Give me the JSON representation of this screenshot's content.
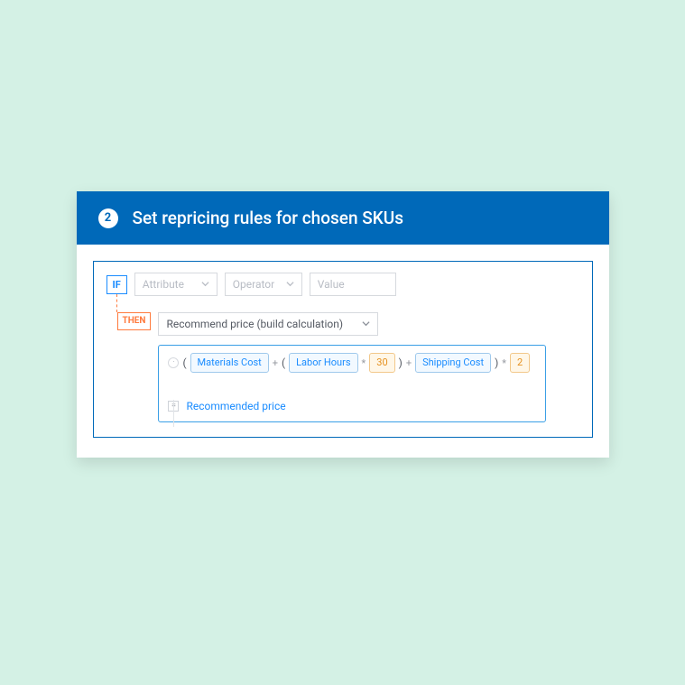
{
  "header": {
    "step_number": "2",
    "title": "Set repricing rules for chosen SKUs"
  },
  "if": {
    "label": "IF",
    "attribute_placeholder": "Attribute",
    "operator_placeholder": "Operator",
    "value_placeholder": "Value"
  },
  "then": {
    "label": "THEN",
    "action": "Recommend price (build calculation)"
  },
  "formula": {
    "tokens": {
      "materials_cost": "Materials Cost",
      "labor_hours": "Labor Hours",
      "rate": "30",
      "shipping_cost": "Shipping Cost",
      "multiplier": "2"
    },
    "result_label": "Recommended price"
  }
}
